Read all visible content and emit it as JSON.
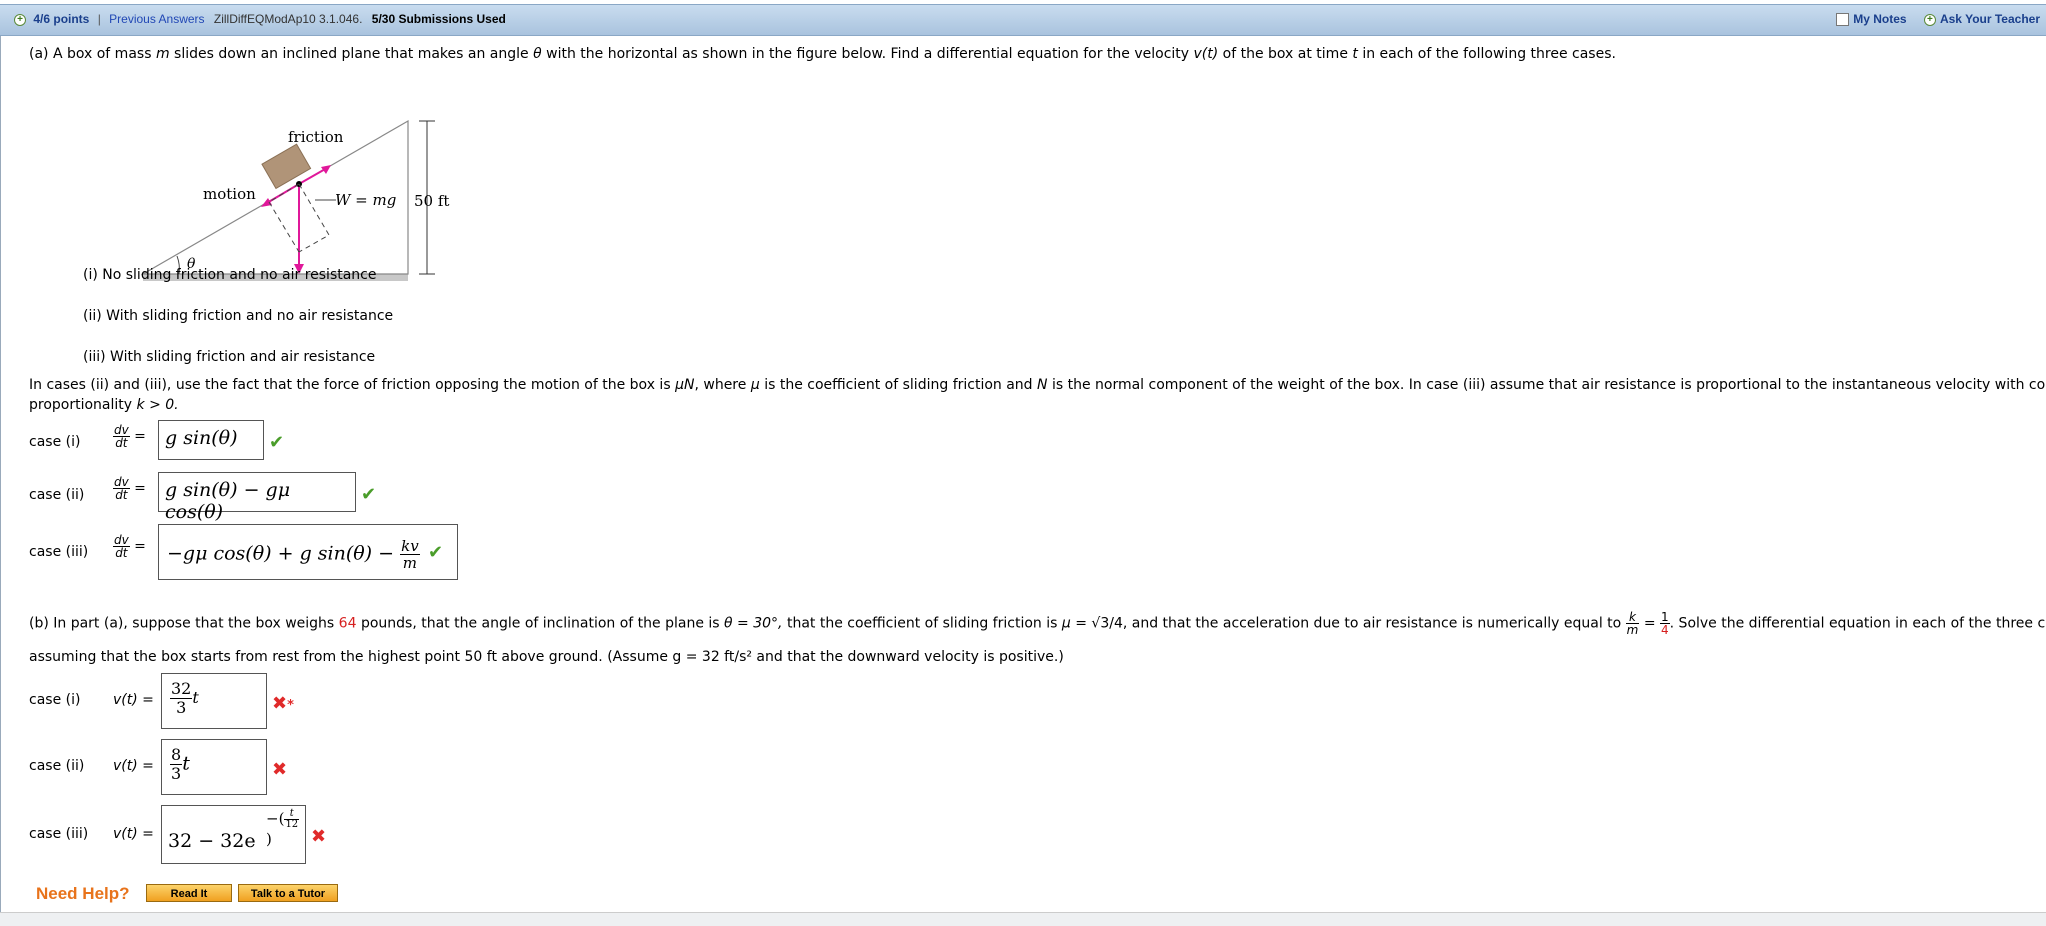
{
  "header": {
    "points": "4/6 points",
    "sep": "|",
    "previous_answers": "Previous Answers",
    "problem_code": "ZillDiffEQModAp10 3.1.046.",
    "submissions": "5/30 Submissions Used",
    "my_notes": "My Notes",
    "ask_teacher": "Ask Your Teacher"
  },
  "part_a": {
    "intro_pre": "(a) A box of mass ",
    "m": "m",
    "intro_mid": " slides down an inclined plane that makes an angle ",
    "theta": "θ",
    "intro_mid2": " with the horizontal as shown in the figure below. Find a differential equation for the velocity ",
    "vt": "v(t)",
    "intro_mid3": " of the box at time ",
    "t": "t",
    "intro_end": " in each of the following three cases.",
    "figure": {
      "friction": "friction",
      "motion": "motion",
      "weight": "W = mg",
      "height": "50 ft",
      "angle": "θ"
    },
    "cases": [
      "(i) No sliding friction and no air resistance",
      "(ii) With sliding friction and no air resistance",
      "(iii) With sliding friction and air resistance"
    ],
    "note_pre": "In cases (ii) and (iii), use the fact that the force of friction opposing the motion of the box is ",
    "muN": "μN",
    "note_mid": ", where ",
    "mu": "μ",
    "note_mid2": " is the coefficient of sliding friction and ",
    "N": "N",
    "note_mid3": " is the normal component of the weight of the box. In case (iii) assume that air resistance is proportional to the instantaneous velocity with constant of",
    "note_line2": "proportionality ",
    "k_gt": "k > 0.",
    "case_labels": [
      "case (i)",
      "case (ii)",
      "case (iii)"
    ],
    "dv": "dv",
    "dt": "dt",
    "eq": "=",
    "answers": [
      "g sin(θ)",
      "g sin(θ) − gμ cos(θ)",
      "−gμ cos(θ) + g sin(θ) −"
    ],
    "kv": "kv",
    "m_den": "m"
  },
  "part_b": {
    "pre": "(b) In part (a), suppose that the box weighs ",
    "weight": "64",
    "mid1": " pounds, that the angle of inclination of the plane is ",
    "theta_eq": "θ = 30°,",
    "mid2": " that the coefficient of sliding friction is ",
    "mu_eq": "μ = ",
    "sqrt3": "√3/4,",
    "mid3": " and that the acceleration due to air resistance is numerically equal to ",
    "k": "k",
    "m": "m",
    "eq": "=",
    "one": "1",
    "four": "4",
    "end": ". Solve the differential equation in each of the three cases,",
    "line2": "assuming that the box starts from rest from the highest point 50 ft above ground. (Assume g = 32 ft/s² and that the downward velocity is positive.)",
    "case_labels": [
      "case (i)",
      "case (ii)",
      "case (iii)"
    ],
    "vt_eq": "v(t) =",
    "ans1_num": "32",
    "ans1_den": "3",
    "ans2_num": "8",
    "ans2_den": "3",
    "t": "t",
    "ans3_base": "32 − 32e",
    "ans3_exp_num": "t",
    "ans3_exp_den": "12",
    "ans3_minus": "−",
    "star": "*"
  },
  "help": {
    "label": "Need Help?",
    "read_it": "Read It",
    "tutor": "Talk to a Tutor"
  }
}
